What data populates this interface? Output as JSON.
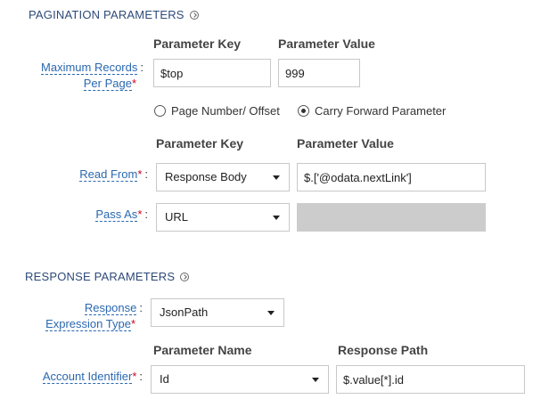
{
  "pagination": {
    "title": "PAGINATION PARAMETERS",
    "header_key": "Parameter Key",
    "header_value": "Parameter Value",
    "max_records": {
      "label_line1": "Maximum Records",
      "label_line2": "Per Page",
      "key": "$top",
      "value": "999"
    },
    "mode_options": {
      "page_number_offset": "Page Number/ Offset",
      "carry_forward": "Carry Forward Parameter",
      "selected": "carry_forward"
    },
    "header_key2": "Parameter Key",
    "header_value2": "Parameter Value",
    "read_from": {
      "label": "Read From",
      "select_value": "Response Body",
      "value": "$.['@odata.nextLink']"
    },
    "pass_as": {
      "label": "Pass As",
      "select_value": "URL",
      "value": ""
    }
  },
  "response": {
    "title": "RESPONSE PARAMETERS",
    "expression_type": {
      "label_line1": "Response",
      "label_line2": "Expression Type",
      "select_value": "JsonPath"
    },
    "header_name": "Parameter Name",
    "header_path": "Response Path",
    "account_identifier": {
      "label": "Account Identifier",
      "select_value": "Id",
      "path": "$.value[*].id"
    }
  },
  "ui": {
    "required_marker": "*",
    "colon": ":"
  }
}
